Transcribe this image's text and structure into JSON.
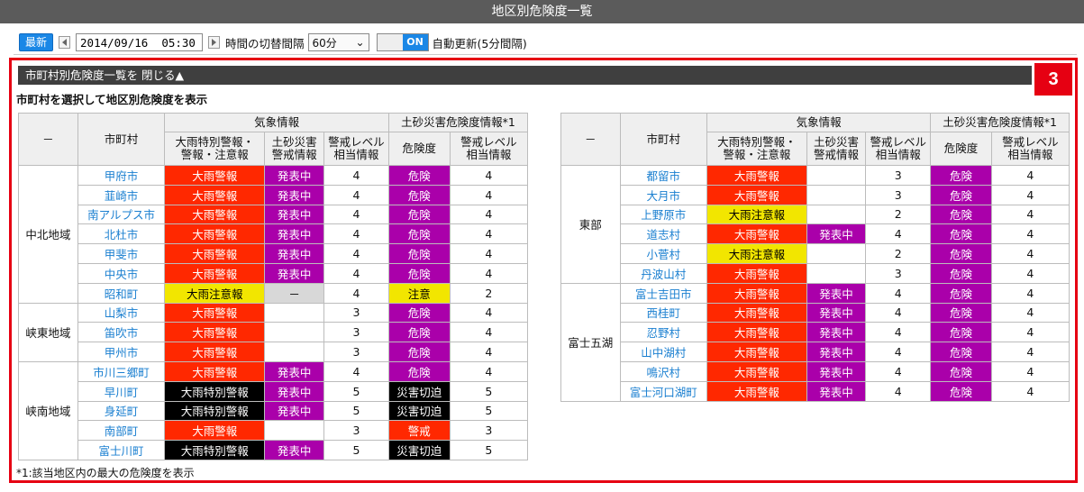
{
  "app": {
    "title": "地区別危険度一覧"
  },
  "toolbar": {
    "latest_label": "最新",
    "datetime_value": "2014/09/16  05:30",
    "interval_label": "時間の切替間隔",
    "interval_value": "60分",
    "toggle_label": "ON",
    "auto_update_label": "自動更新(5分間隔)",
    "prev_icon": "triangle-left-icon",
    "next_icon": "triangle-right-icon"
  },
  "panel": {
    "badge": "3",
    "toggle_header": "市町村別危険度一覧を 閉じる▲",
    "subtitle": "市町村を選択して地区別危険度を表示",
    "footnote": "*1:該当地区内の最大の危険度を表示"
  },
  "colors": {
    "大雨警報": "#ff2800",
    "大雨特別警報": "#000000",
    "大雨注意報": "#f2e600",
    "発表中": "#aa00aa",
    "危険": "#aa00aa",
    "災害切迫": "#000000",
    "警戒": "#ff2800",
    "注意": "#f2e600",
    "accent": "#1a87e6",
    "frame": "#e60012"
  },
  "headers": {
    "region": "－",
    "municipality": "市町村",
    "weather_group": "気象情報",
    "sediment_group": "土砂災害危険度情報*1",
    "heavy_rain": "大雨特別警報・\n警報・注意報",
    "landslide": "土砂災害\n警戒情報",
    "level_weather": "警戒レベル\n相当情報",
    "risk": "危険度",
    "level_sediment": "警戒レベル\n相当情報"
  },
  "left_table": {
    "regions": [
      {
        "name": "中北地域",
        "rows": [
          {
            "municipality": "甲府市",
            "heavy_rain": "大雨警報",
            "landslide": "発表中",
            "level_w": "4",
            "risk": "危険",
            "level_s": "4"
          },
          {
            "municipality": "韮崎市",
            "heavy_rain": "大雨警報",
            "landslide": "発表中",
            "level_w": "4",
            "risk": "危険",
            "level_s": "4"
          },
          {
            "municipality": "南アルプス市",
            "heavy_rain": "大雨警報",
            "landslide": "発表中",
            "level_w": "4",
            "risk": "危険",
            "level_s": "4"
          },
          {
            "municipality": "北杜市",
            "heavy_rain": "大雨警報",
            "landslide": "発表中",
            "level_w": "4",
            "risk": "危険",
            "level_s": "4"
          },
          {
            "municipality": "甲斐市",
            "heavy_rain": "大雨警報",
            "landslide": "発表中",
            "level_w": "4",
            "risk": "危険",
            "level_s": "4"
          },
          {
            "municipality": "中央市",
            "heavy_rain": "大雨警報",
            "landslide": "発表中",
            "level_w": "4",
            "risk": "危険",
            "level_s": "4"
          },
          {
            "municipality": "昭和町",
            "heavy_rain": "大雨注意報",
            "landslide": "－",
            "level_w": "4",
            "risk": "注意",
            "level_s": "2"
          }
        ]
      },
      {
        "name": "峡東地域",
        "rows": [
          {
            "municipality": "山梨市",
            "heavy_rain": "大雨警報",
            "landslide": "",
            "level_w": "3",
            "risk": "危険",
            "level_s": "4"
          },
          {
            "municipality": "笛吹市",
            "heavy_rain": "大雨警報",
            "landslide": "",
            "level_w": "3",
            "risk": "危険",
            "level_s": "4"
          },
          {
            "municipality": "甲州市",
            "heavy_rain": "大雨警報",
            "landslide": "",
            "level_w": "3",
            "risk": "危険",
            "level_s": "4"
          }
        ]
      },
      {
        "name": "峡南地域",
        "rows": [
          {
            "municipality": "市川三郷町",
            "heavy_rain": "大雨警報",
            "landslide": "発表中",
            "level_w": "4",
            "risk": "危険",
            "level_s": "4"
          },
          {
            "municipality": "早川町",
            "heavy_rain": "大雨特別警報",
            "landslide": "発表中",
            "level_w": "5",
            "risk": "災害切迫",
            "level_s": "5"
          },
          {
            "municipality": "身延町",
            "heavy_rain": "大雨特別警報",
            "landslide": "発表中",
            "level_w": "5",
            "risk": "災害切迫",
            "level_s": "5"
          },
          {
            "municipality": "南部町",
            "heavy_rain": "大雨警報",
            "landslide": "",
            "level_w": "3",
            "risk": "警戒",
            "level_s": "3"
          },
          {
            "municipality": "富士川町",
            "heavy_rain": "大雨特別警報",
            "landslide": "発表中",
            "level_w": "5",
            "risk": "災害切迫",
            "level_s": "5"
          }
        ]
      }
    ]
  },
  "right_table": {
    "regions": [
      {
        "name": "東部",
        "rows": [
          {
            "municipality": "都留市",
            "heavy_rain": "大雨警報",
            "landslide": "",
            "level_w": "3",
            "risk": "危険",
            "level_s": "4"
          },
          {
            "municipality": "大月市",
            "heavy_rain": "大雨警報",
            "landslide": "",
            "level_w": "3",
            "risk": "危険",
            "level_s": "4"
          },
          {
            "municipality": "上野原市",
            "heavy_rain": "大雨注意報",
            "landslide": "",
            "level_w": "2",
            "risk": "危険",
            "level_s": "4"
          },
          {
            "municipality": "道志村",
            "heavy_rain": "大雨警報",
            "landslide": "発表中",
            "level_w": "4",
            "risk": "危険",
            "level_s": "4"
          },
          {
            "municipality": "小菅村",
            "heavy_rain": "大雨注意報",
            "landslide": "",
            "level_w": "2",
            "risk": "危険",
            "level_s": "4"
          },
          {
            "municipality": "丹波山村",
            "heavy_rain": "大雨警報",
            "landslide": "",
            "level_w": "3",
            "risk": "危険",
            "level_s": "4"
          }
        ]
      },
      {
        "name": "富士五湖",
        "rows": [
          {
            "municipality": "富士吉田市",
            "heavy_rain": "大雨警報",
            "landslide": "発表中",
            "level_w": "4",
            "risk": "危険",
            "level_s": "4"
          },
          {
            "municipality": "西桂町",
            "heavy_rain": "大雨警報",
            "landslide": "発表中",
            "level_w": "4",
            "risk": "危険",
            "level_s": "4"
          },
          {
            "municipality": "忍野村",
            "heavy_rain": "大雨警報",
            "landslide": "発表中",
            "level_w": "4",
            "risk": "危険",
            "level_s": "4"
          },
          {
            "municipality": "山中湖村",
            "heavy_rain": "大雨警報",
            "landslide": "発表中",
            "level_w": "4",
            "risk": "危険",
            "level_s": "4"
          },
          {
            "municipality": "鳴沢村",
            "heavy_rain": "大雨警報",
            "landslide": "発表中",
            "level_w": "4",
            "risk": "危険",
            "level_s": "4"
          },
          {
            "municipality": "富士河口湖町",
            "heavy_rain": "大雨警報",
            "landslide": "発表中",
            "level_w": "4",
            "risk": "危険",
            "level_s": "4"
          }
        ]
      }
    ]
  }
}
